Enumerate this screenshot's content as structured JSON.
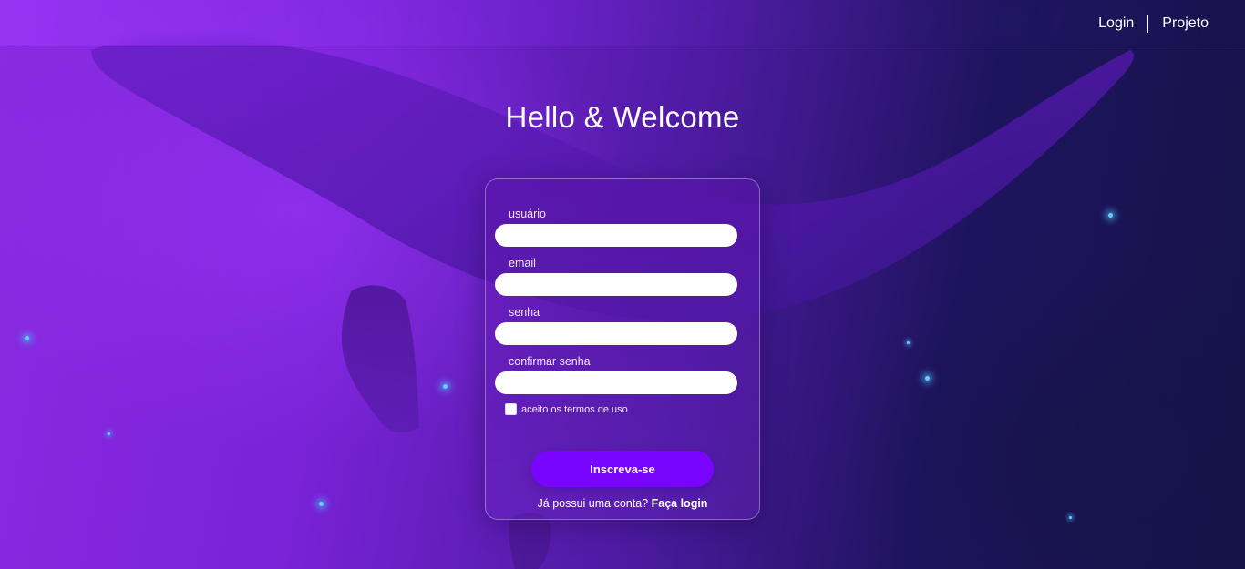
{
  "nav": {
    "login_label": "Login",
    "project_label": "Projeto"
  },
  "page": {
    "title": "Hello & Welcome"
  },
  "form": {
    "fields": [
      {
        "label": "usuário",
        "value": "",
        "placeholder": ""
      },
      {
        "label": "email",
        "value": "",
        "placeholder": ""
      },
      {
        "label": "senha",
        "value": "",
        "placeholder": ""
      },
      {
        "label": "confirmar senha",
        "value": "",
        "placeholder": ""
      }
    ],
    "terms_label": "aceito os termos de uso",
    "terms_checked": false,
    "submit_label": "Inscreva-se",
    "have_account_text": "Já possui uma conta?",
    "login_link_label": "Faça login"
  },
  "colors": {
    "accent": "#7a05ff",
    "background_left": "#8a2be2",
    "background_right": "#151347",
    "particle": "#5fd0ff"
  },
  "icons": {
    "background_illustration": "whale-illustration"
  }
}
